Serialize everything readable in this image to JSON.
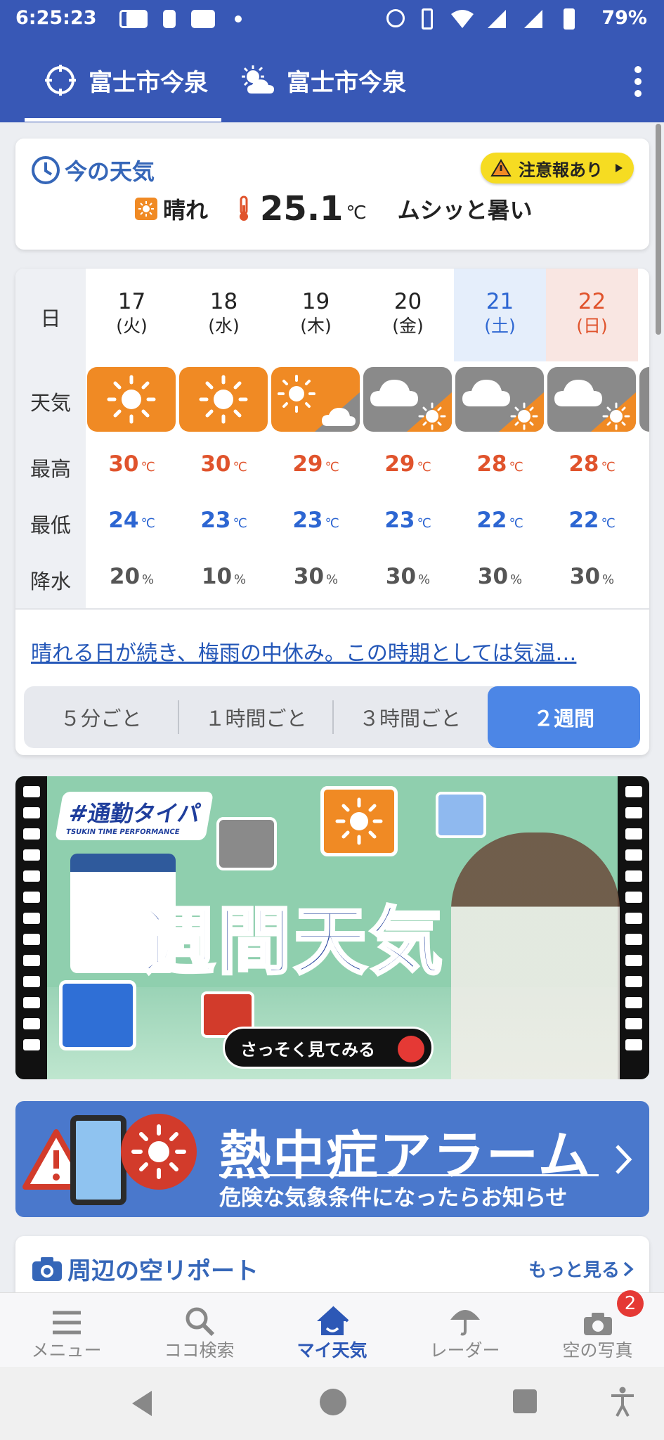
{
  "status_bar": {
    "time": "6:25:23",
    "battery": "79%"
  },
  "header": {
    "tabs": [
      {
        "label": "富士市今泉"
      },
      {
        "label": "富士市今泉"
      }
    ]
  },
  "now": {
    "title": "今の天気",
    "alert": "注意報あり",
    "condition": "晴れ",
    "temp": "25.1",
    "unit": "℃",
    "comment": "ムシッと暑い"
  },
  "forecast": {
    "labels": {
      "day": "日",
      "weather": "天気",
      "high": "最高",
      "low": "最低",
      "precip": "降水"
    },
    "days": [
      {
        "date": "17",
        "weekday": "(火)",
        "icon": "sunny",
        "high": "30",
        "low": "24",
        "precip": "20"
      },
      {
        "date": "18",
        "weekday": "(水)",
        "icon": "sunny",
        "high": "30",
        "low": "23",
        "precip": "10"
      },
      {
        "date": "19",
        "weekday": "(木)",
        "icon": "sunny-then-cloudy",
        "high": "29",
        "low": "23",
        "precip": "30"
      },
      {
        "date": "20",
        "weekday": "(金)",
        "icon": "cloudy-then-sunny",
        "high": "29",
        "low": "23",
        "precip": "30"
      },
      {
        "date": "21",
        "weekday": "(土)",
        "icon": "cloudy-then-sunny",
        "high": "28",
        "low": "22",
        "precip": "30"
      },
      {
        "date": "22",
        "weekday": "(日)",
        "icon": "cloudy-then-sunny",
        "high": "28",
        "low": "22",
        "precip": "30"
      }
    ],
    "temp_unit": "℃",
    "precip_unit": "%",
    "summary": "晴れる日が続き、梅雨の中休み。この時期としては気温…",
    "segments": [
      "５分ごと",
      "１時間ごと",
      "３時間ごと",
      "２週間"
    ]
  },
  "banner1": {
    "tag": "#通勤タイパ",
    "tag_sub": "TSUKIN TIME PERFORMANCE",
    "title": "週間天気",
    "cta": "さっそく見てみる"
  },
  "banner2": {
    "title": "熱中症アラーム",
    "subtitle": "危険な気象条件になったらお知らせ"
  },
  "sky_report": {
    "title": "周辺の空リポート",
    "more": "もっと見る"
  },
  "bottom_nav": {
    "items": [
      {
        "label": "メニュー"
      },
      {
        "label": "ココ検索"
      },
      {
        "label": "マイ天気"
      },
      {
        "label": "レーダー"
      },
      {
        "label": "空の写真"
      }
    ],
    "photo_badge": "2"
  },
  "colors": {
    "brand": "#3858b6",
    "sunny": "#f08a24",
    "cloudy": "#8a8a8a",
    "high": "#e0532c",
    "low": "#2d66d2",
    "saturday_bg": "#e5eefb",
    "sunday_bg": "#f9e6e2"
  }
}
